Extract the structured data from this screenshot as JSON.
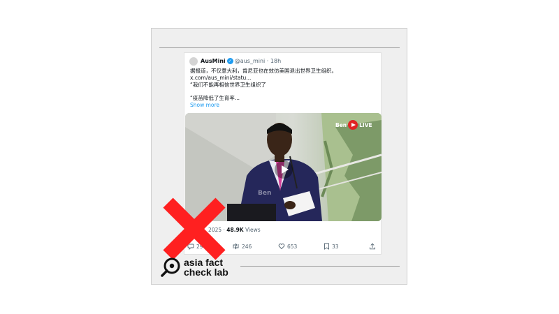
{
  "tweet": {
    "name": "AusMini",
    "handle": "@aus_mini",
    "time": "18h",
    "lines": [
      "据报道，不仅意大利，肯尼亚也在效仿美国退出世界卫生组织。",
      "x.com/aus_mini/statu...",
      "“我们不能再相信世界卫生组织了",
      "“疫苗降低了生育率..."
    ],
    "show_more": "Show more",
    "video_watermark": "Ben",
    "live_label": "LIVE",
    "overlay_text": "Ben",
    "date_fragment": "an 28, 2025 · ",
    "views_value": "48.9K",
    "views_label": " Views",
    "replies": "29",
    "retweets": "246",
    "likes": "653",
    "bookmarks": "33"
  },
  "logo": {
    "line1": "asia fact",
    "line2": "check lab"
  },
  "colors": {
    "accent": "#1d9bf0",
    "x_mark": "#ff2020"
  },
  "icons": [
    "verified-icon",
    "play-icon",
    "live-icon",
    "reply-icon",
    "retweet-icon",
    "like-icon",
    "bookmark-icon",
    "share-icon",
    "cross-mark-icon",
    "magnifier-logo-icon"
  ]
}
